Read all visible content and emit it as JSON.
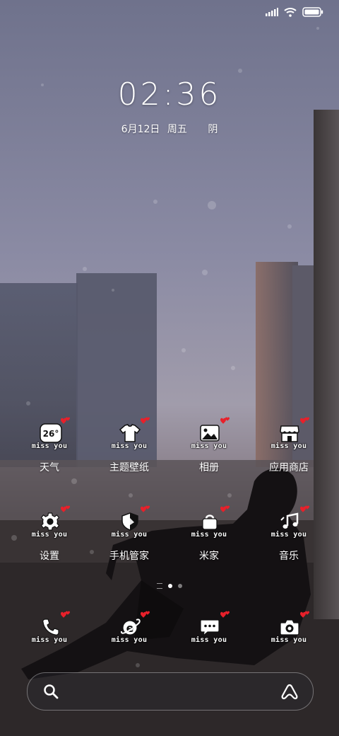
{
  "status_bar": {
    "icons": [
      "signal-icon",
      "wifi-icon",
      "battery-icon"
    ]
  },
  "lockscreen": {
    "time": "02:36",
    "date": "6月12日",
    "weekday": "周五",
    "weather": "阴"
  },
  "apps_row1": [
    {
      "label": "天气",
      "icon": "weather-icon",
      "badge_text": "26°",
      "sticker": "miss you"
    },
    {
      "label": "主题壁纸",
      "icon": "theme-shirt-icon",
      "sticker": "miss you"
    },
    {
      "label": "相册",
      "icon": "gallery-icon",
      "sticker": "miss you"
    },
    {
      "label": "应用商店",
      "icon": "app-store-icon",
      "sticker": "miss you"
    }
  ],
  "apps_row2": [
    {
      "label": "设置",
      "icon": "gear-icon",
      "sticker": "miss you"
    },
    {
      "label": "手机管家",
      "icon": "security-shield-icon",
      "sticker": "miss you"
    },
    {
      "label": "米家",
      "icon": "home-bag-icon",
      "sticker": "miss you"
    },
    {
      "label": "音乐",
      "icon": "music-note-icon",
      "sticker": "miss you"
    }
  ],
  "dock": [
    {
      "label": "",
      "icon": "phone-icon",
      "sticker": "miss you"
    },
    {
      "label": "",
      "icon": "browser-icon",
      "sticker": "miss you"
    },
    {
      "label": "",
      "icon": "message-icon",
      "sticker": "miss you"
    },
    {
      "label": "",
      "icon": "camera-icon",
      "sticker": "miss you"
    }
  ],
  "page_indicator": {
    "pages": 2,
    "current": 1
  },
  "search_bar": {
    "icons": [
      "search-icon",
      "assistant-icon"
    ]
  },
  "colors": {
    "heart": "#e8202a",
    "sky_top": "#7c7f9a",
    "ground": "#2a2626"
  }
}
